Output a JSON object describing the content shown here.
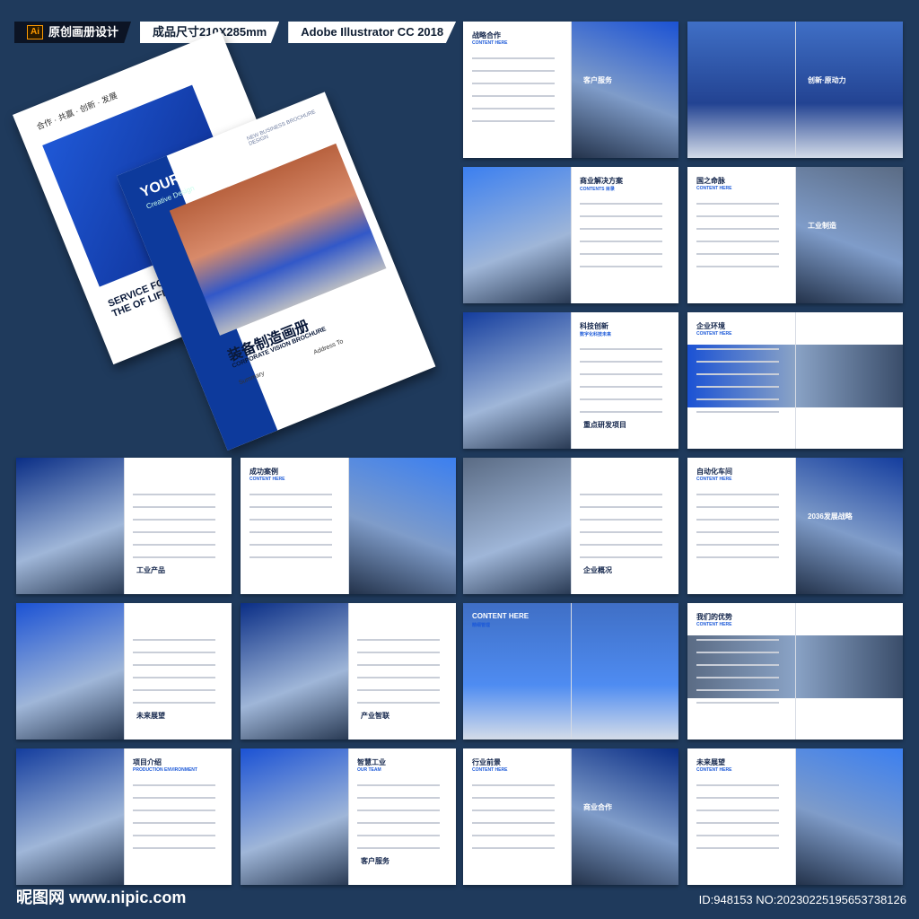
{
  "header": {
    "ai_badge": "Ai",
    "tag1": "原创画册设计",
    "tag2": "成品尺寸210X285mm",
    "tag3": "Adobe Illustrator CC 2018"
  },
  "cover_back": {
    "top_text": "合作 · 共赢 · 创新 · 发展",
    "bottom_text": "SERVICE FOR PATIENT IMPROVE THE OF LIFE"
  },
  "cover_front": {
    "logo": "YOUR LOGO",
    "logo_sub": "Creative Design",
    "corner": "NEW BUSINESS BROCHURE DESIGN",
    "title": "装备制造画册",
    "title_en": "CORPORATE VISION BROCHURE",
    "summary": "Summary",
    "address": "Address To"
  },
  "spreads": [
    {
      "title": "战略合作",
      "sub": "CONTENT HERE",
      "right_title": "客户服务"
    },
    {
      "title": "",
      "sub": "",
      "right_title": "创新·原动力"
    },
    {
      "title": "商业解决方案",
      "sub": "CONTENTS 目录",
      "right_title": ""
    },
    {
      "title": "国之命脉",
      "sub": "CONTENT HERE",
      "right_title": "工业制造"
    },
    {
      "title": "科技创新",
      "sub": "数字化科技未来",
      "right_title": "重点研发项目"
    },
    {
      "title": "企业环境",
      "sub": "CONTENT HERE",
      "right_title": ""
    },
    {
      "title": "",
      "sub": "",
      "right_title": "工业产品"
    },
    {
      "title": "成功案例",
      "sub": "CONTENT HERE",
      "right_title": ""
    },
    {
      "title": "",
      "sub": "",
      "right_title": "企业概况"
    },
    {
      "title": "自动化车间",
      "sub": "CONTENT HERE",
      "right_title": "2036发展战略"
    },
    {
      "title": "",
      "sub": "",
      "right_title": "未来展望"
    },
    {
      "title": "",
      "sub": "",
      "right_title": "产业智联"
    },
    {
      "title": "CONTENT HERE",
      "sub": "精细管理",
      "right_title": ""
    },
    {
      "title": "我们的优势",
      "sub": "CONTENT HERE",
      "right_title": ""
    },
    {
      "title": "项目介绍",
      "sub": "PRODUCTION ENVIRONMENT",
      "right_title": ""
    },
    {
      "title": "智慧工业",
      "sub": "OUR TEAM",
      "right_title": "客户服务"
    },
    {
      "title": "行业前景",
      "sub": "CONTENT HERE",
      "right_title": "商业合作"
    },
    {
      "title": "未来展望",
      "sub": "CONTENT HERE",
      "right_title": ""
    }
  ],
  "footer": {
    "logo": "昵图网 www.nipic.com",
    "id": "ID:948153 NO:20230225195653738126"
  }
}
